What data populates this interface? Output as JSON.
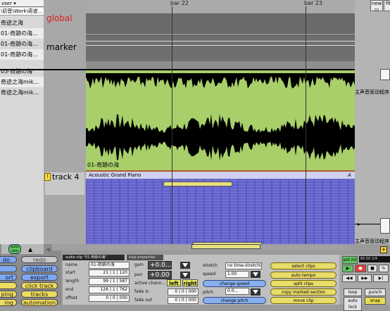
{
  "browser": {
    "header": "vser",
    "path": "\\初音\\Work\\奇迹...",
    "files": [
      "奇迹之海",
      "01-奇跡の海...",
      "01-奇跡の海...",
      "01-奇跡の海...",
      "03-奇跡の海",
      "奇迹之海mik...",
      "奇迹之海mik..."
    ]
  },
  "tracks": {
    "global": "global",
    "marker": "marker",
    "track4": "track 4",
    "track4_indicator": "!"
  },
  "ruler": {
    "bar1": "bar 22",
    "bar2": "bar 23"
  },
  "clips": {
    "audio_name": "01-奇跡の海",
    "midi_name": "Acoustic Grand Piano",
    "midi_flag": "A"
  },
  "right_panel": {
    "new_button": "new",
    "fit_button": "fit",
    "cn_label_1": "主声音驱动程序",
    "cn_label_2": "主声音驱动程序"
  },
  "bottom_left": {
    "auto_size": "auto size",
    "undo": "do",
    "redo": "redo",
    "clipboard": "clipboard",
    "ort": "ort",
    "export": "export",
    "click_track": "click track",
    "ping": "ping",
    "tracks": "tracks",
    "ing": "ing",
    "automation": "automation"
  },
  "inspector": {
    "tab_title": "audio clip \"01-奇跡の海\"",
    "tab_loop": "loop properties",
    "name_label": "name",
    "name_value": "01-奇跡の海",
    "start_label": "start",
    "start_value": "21 | 1 | 120",
    "length_label": "length",
    "length_value": "99 | 1 | 587",
    "end_label": "end",
    "end_value": "126 | 1 | 762",
    "offset_label": "offset",
    "offset_value": "0 | 0 | 000",
    "gain_label": "gain",
    "gain_value": "+0.0...",
    "pan_label": "pan",
    "pan_value": "+0.00",
    "active_channels_label": "active chann...",
    "left_button": "left",
    "right_button": "right",
    "fade_in_label": "fade in",
    "fade_in_value": "0 | 0 | 000",
    "fade_out_label": "fade out",
    "fade_out_value": "0 | 0 | 000",
    "stretch_label": "stretch",
    "stretch_value": "no time-stretching",
    "speed_label": "speed",
    "speed_value": "1.00",
    "change_speed": "change speed",
    "pitch_label": "pitch",
    "pitch_value": "0.0...",
    "change_pitch": "change pitch",
    "select_clips": "select clips",
    "auto_tempo": "auto tempo",
    "split_clips": "split clips",
    "copy_marked_section": "copy marked section",
    "move_clip": "move clip"
  },
  "transport": {
    "ext_midi": "ext mi",
    "bpm": "60.00",
    "sig": "2/4",
    "loop": "loop",
    "punch": "punch",
    "auto_lock": "auto lock",
    "snap": "snap"
  }
}
